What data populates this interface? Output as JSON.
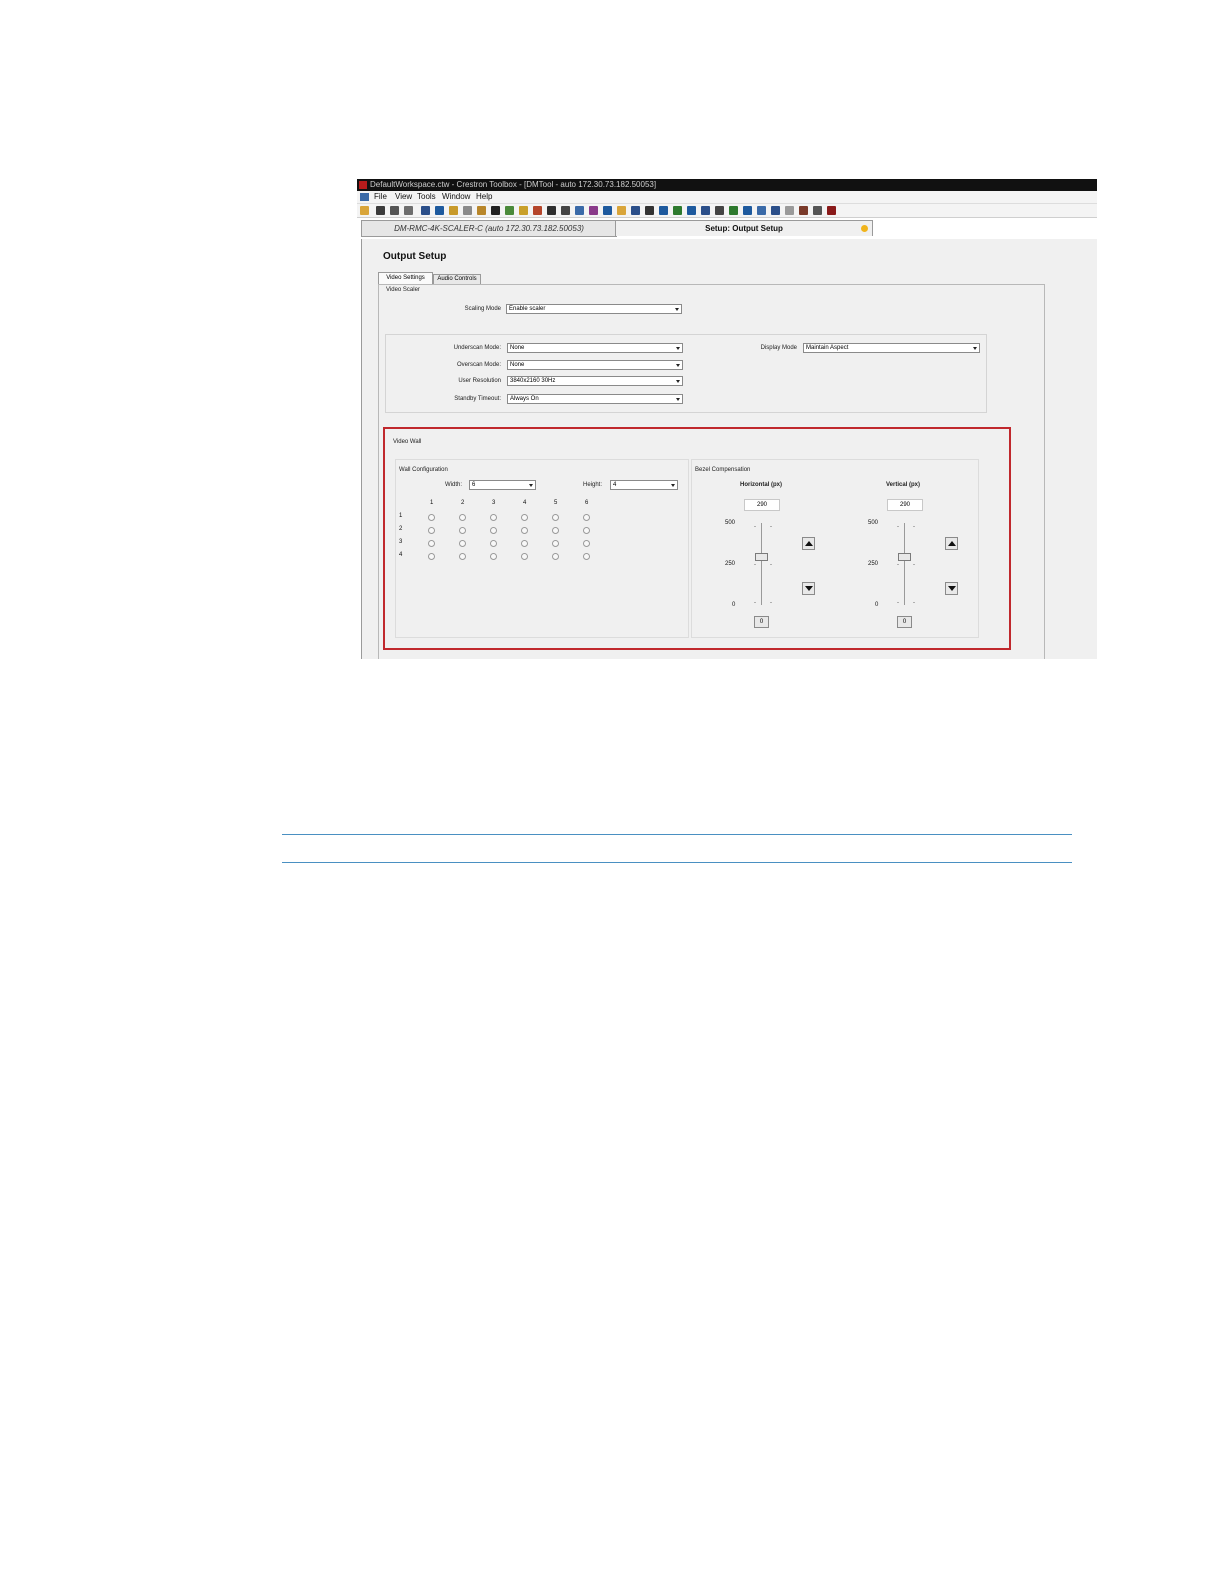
{
  "window": {
    "title": "DefaultWorkspace.ctw - Crestron Toolbox - [DMTool - auto 172.30.73.182.50053]"
  },
  "menu": {
    "items": [
      "File",
      "View",
      "Tools",
      "Window",
      "Help"
    ]
  },
  "doc_tabs": {
    "device": "DM-RMC-4K-SCALER-C (auto 172.30.73.182.50053)",
    "active": "Setup: Output Setup"
  },
  "page": {
    "title": "Output Setup",
    "tabs": [
      "Video Settings",
      "Audio Controls"
    ],
    "group_label": "Video Scaler"
  },
  "video_scaler": {
    "scaling_mode_label": "Scaling Mode",
    "scaling_mode_value": "Enable scaler",
    "underscan_label": "Underscan Mode:",
    "underscan_value": "None",
    "overscan_label": "Overscan Mode:",
    "overscan_value": "None",
    "resolution_label": "User Resolution",
    "resolution_value": "3840x2160 30Hz",
    "standby_label": "Standby Timeout:",
    "standby_value": "Always On",
    "display_mode_label": "Display Mode",
    "display_mode_value": "Maintain Aspect"
  },
  "video_wall": {
    "title": "Video Wall",
    "wall_config_label": "Wall Configuration",
    "width_label": "Width:",
    "width_value": "6",
    "height_label": "Height:",
    "height_value": "4",
    "column_numbers": [
      "1",
      "2",
      "3",
      "4",
      "5",
      "6"
    ],
    "row_numbers": [
      "1",
      "2",
      "3",
      "4"
    ],
    "bezel_label": "Bezel Compensation",
    "horizontal": {
      "label": "Horizontal (px)",
      "value": "290",
      "max": "500",
      "mid": "250",
      "min": "0",
      "reset_label": "0",
      "level_fraction": 0.58
    },
    "vertical": {
      "label": "Vertical (px)",
      "value": "290",
      "max": "500",
      "mid": "250",
      "min": "0",
      "reset_label": "0",
      "level_fraction": 0.58
    }
  },
  "colors": {
    "highlight_border": "#c0282d",
    "rule_line": "#4a90c2"
  }
}
